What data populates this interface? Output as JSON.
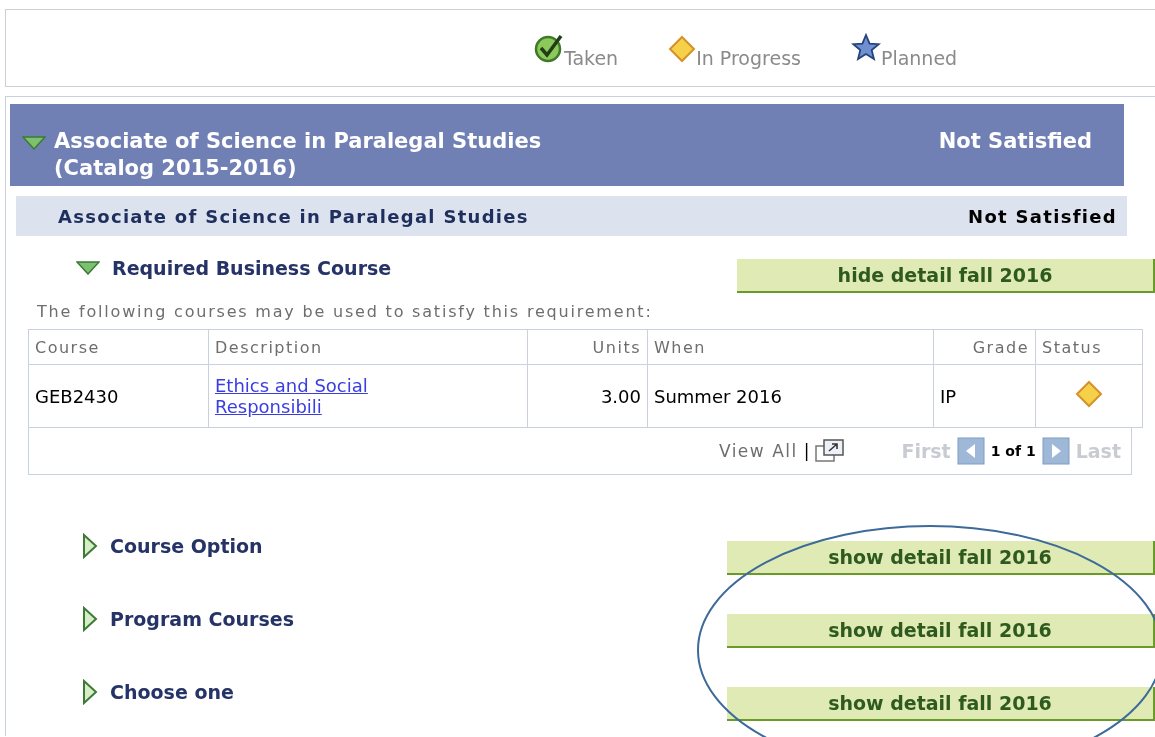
{
  "legend": [
    {
      "kind": "taken",
      "label": "Taken"
    },
    {
      "kind": "in_progress",
      "label": "In Progress"
    },
    {
      "kind": "planned",
      "label": "Planned"
    }
  ],
  "program": {
    "title": "Associate of Science in Paralegal Studies (Catalog 2015-2016)",
    "status": "Not Satisfied",
    "expanded": true
  },
  "subprogram": {
    "title": "Associate of Science in Paralegal Studies",
    "status": "Not Satisfied"
  },
  "requirements": [
    {
      "title": "Required Business Course",
      "expanded": true,
      "button": "hide detail fall 2016",
      "description": "The following courses may be used to satisfy this requirement:",
      "table": {
        "columns": [
          "Course",
          "Description",
          "Units",
          "When",
          "Grade",
          "Status"
        ],
        "rows": [
          {
            "course": "GEB2430",
            "description": "Ethics and Social Responsibili",
            "units": "3.00",
            "when": "Summer 2016",
            "grade": "IP",
            "kind": "in_progress"
          }
        ],
        "footer": {
          "view_all": "View All",
          "separator": "|",
          "first": "First",
          "range": "1 of 1",
          "last": "Last"
        }
      }
    },
    {
      "title": "Course Option",
      "expanded": false,
      "button": "show detail fall 2016"
    },
    {
      "title": "Program Courses",
      "expanded": false,
      "button": "show detail fall 2016"
    },
    {
      "title": "Choose one",
      "expanded": false,
      "button": "show detail fall 2016"
    }
  ]
}
